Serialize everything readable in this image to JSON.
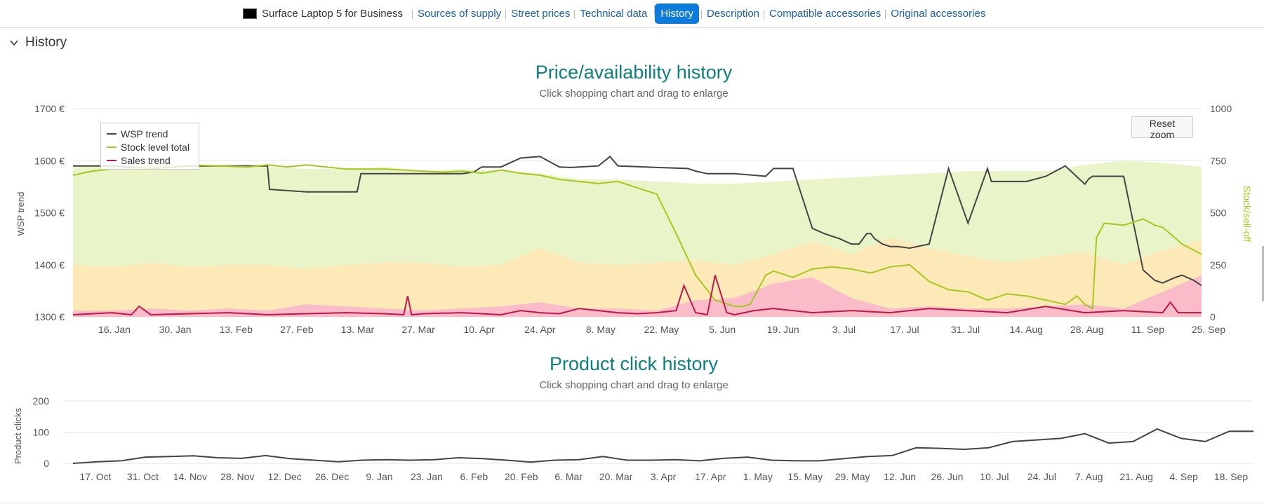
{
  "nav": {
    "product": "Surface Laptop 5 for Business",
    "items": [
      {
        "label": "Sources of supply",
        "active": false
      },
      {
        "label": "Street prices",
        "active": false
      },
      {
        "label": "Technical data",
        "active": false
      },
      {
        "label": "History",
        "active": true
      },
      {
        "label": "Description",
        "active": false
      },
      {
        "label": "Compatible accessories",
        "active": false
      },
      {
        "label": "Original accessories",
        "active": false
      }
    ]
  },
  "section": {
    "title": "History"
  },
  "colors": {
    "wsp": "#444444",
    "stock": "#a5c81e",
    "sales": "#c0174b",
    "band_green": "#e9f5c8",
    "band_yellow": "#fde9b8",
    "band_red": "#f9bcc8",
    "title": "#0d7f7f",
    "accent": "#0c7bdc"
  },
  "chart_data": [
    {
      "type": "line",
      "title": "Price/availability history",
      "subtitle": "Click shopping chart and drag to enlarge",
      "reset_label": "Reset zoom",
      "ylabel": "WSP trend",
      "y2label": "Stock/sell-off",
      "ylim": [
        1300,
        1700
      ],
      "y_ticks": [
        1300,
        1400,
        1500,
        1600,
        1700
      ],
      "y_tick_labels": [
        "1300 €",
        "1400 €",
        "1500 €",
        "1600 €",
        "1700 €"
      ],
      "y2lim": [
        0,
        1000
      ],
      "y2_ticks": [
        "0",
        "250",
        "500",
        "750",
        "1000"
      ],
      "x_ticks": [
        "16. Jan",
        "30. Jan",
        "13. Feb",
        "27. Feb",
        "13. Mar",
        "27. Mar",
        "10. Apr",
        "24. Apr",
        "8. May",
        "22. May",
        "5. Jun",
        "19. Jun",
        "3. Jul",
        "17. Jul",
        "31. Jul",
        "14. Aug",
        "28. Aug",
        "11. Sep",
        "25. Sep"
      ],
      "xlim_days": [
        0,
        270
      ],
      "legend_position": "top-left",
      "series": [
        {
          "name": "WSP trend",
          "axis": "left",
          "x": [
            0,
            5,
            10,
            20,
            30,
            35,
            40,
            50,
            50.5,
            60,
            65,
            73,
            74,
            85,
            90,
            100,
            103,
            105,
            108,
            110,
            115,
            120,
            125,
            128,
            130,
            135,
            138,
            140,
            150,
            158,
            160,
            163,
            170,
            175,
            178,
            180,
            185,
            190,
            193,
            197,
            200,
            202,
            203,
            204,
            205,
            206,
            208,
            210,
            212,
            215,
            220,
            225,
            230,
            235,
            236,
            237,
            240,
            245,
            250,
            255,
            260,
            261,
            262,
            263,
            265,
            270,
            275,
            278,
            280,
            283,
            285,
            288,
            290
          ],
          "y": [
            1590,
            1590,
            1590,
            1585,
            1590,
            1590,
            1590,
            1590,
            1545,
            1540,
            1540,
            1540,
            1575,
            1575,
            1575,
            1575,
            1578,
            1588,
            1588,
            1588,
            1605,
            1608,
            1588,
            1587,
            1588,
            1590,
            1608,
            1590,
            1587,
            1585,
            1580,
            1575,
            1575,
            1572,
            1570,
            1585,
            1585,
            1470,
            1460,
            1450,
            1440,
            1440,
            1450,
            1460,
            1460,
            1450,
            1440,
            1435,
            1435,
            1432,
            1440,
            1585,
            1480,
            1585,
            1560,
            1560,
            1560,
            1560,
            1570,
            1590,
            1555,
            1565,
            1570,
            1570,
            1570,
            1570,
            1390,
            1370,
            1365,
            1375,
            1380,
            1370,
            1360
          ]
        },
        {
          "name": "Stock level total",
          "axis": "right",
          "x": [
            0,
            5,
            10,
            20,
            30,
            45,
            50,
            55,
            60,
            70,
            80,
            90,
            95,
            100,
            105,
            110,
            115,
            120,
            125,
            130,
            135,
            140,
            145,
            150,
            155,
            160,
            165,
            170,
            172,
            174,
            178,
            180,
            185,
            190,
            195,
            200,
            205,
            210,
            215,
            220,
            225,
            230,
            235,
            240,
            245,
            250,
            255,
            258,
            260,
            262,
            263,
            265,
            270,
            275,
            278,
            280,
            285,
            290
          ],
          "y": [
            680,
            700,
            710,
            715,
            730,
            720,
            730,
            720,
            730,
            710,
            710,
            700,
            695,
            700,
            690,
            705,
            690,
            680,
            660,
            650,
            640,
            650,
            620,
            590,
            400,
            200,
            80,
            50,
            50,
            60,
            200,
            220,
            190,
            230,
            240,
            230,
            210,
            240,
            250,
            170,
            130,
            120,
            80,
            110,
            100,
            80,
            60,
            100,
            60,
            40,
            380,
            450,
            440,
            470,
            440,
            430,
            350,
            300
          ]
        },
        {
          "name": "Sales trend",
          "axis": "right",
          "x": [
            0,
            10,
            15,
            17,
            20,
            30,
            40,
            50,
            60,
            70,
            80,
            85,
            86,
            87,
            90,
            100,
            110,
            115,
            120,
            125,
            130,
            135,
            140,
            145,
            150,
            155,
            157,
            160,
            163,
            165,
            168,
            170,
            175,
            180,
            190,
            200,
            210,
            220,
            230,
            240,
            250,
            260,
            270,
            280,
            282,
            284,
            290
          ],
          "y": [
            10,
            20,
            10,
            50,
            10,
            15,
            20,
            10,
            15,
            20,
            15,
            10,
            100,
            10,
            15,
            20,
            10,
            30,
            20,
            15,
            40,
            30,
            20,
            15,
            20,
            30,
            150,
            20,
            10,
            200,
            20,
            10,
            30,
            40,
            20,
            30,
            20,
            40,
            30,
            20,
            50,
            20,
            30,
            20,
            70,
            20,
            20
          ]
        }
      ],
      "bands": [
        {
          "name": "green",
          "x": [
            0,
            10,
            20,
            30,
            40,
            50,
            60,
            70,
            80,
            90,
            100,
            110,
            120,
            130,
            140,
            150,
            160,
            170,
            180,
            190,
            200,
            210,
            220,
            230,
            240,
            250,
            260,
            270,
            280,
            290
          ],
          "y": [
            730,
            720,
            720,
            730,
            730,
            720,
            710,
            710,
            720,
            700,
            710,
            700,
            690,
            660,
            660,
            650,
            640,
            640,
            650,
            660,
            670,
            680,
            690,
            700,
            700,
            700,
            730,
            750,
            740,
            720
          ]
        },
        {
          "name": "yellow",
          "x": [
            0,
            10,
            20,
            30,
            40,
            50,
            60,
            70,
            80,
            90,
            100,
            110,
            120,
            130,
            140,
            150,
            160,
            170,
            180,
            190,
            200,
            210,
            220,
            230,
            240,
            250,
            260,
            270,
            280,
            290
          ],
          "y": [
            250,
            240,
            260,
            240,
            250,
            250,
            230,
            250,
            260,
            260,
            240,
            250,
            330,
            260,
            250,
            260,
            270,
            250,
            300,
            360,
            300,
            380,
            330,
            290,
            260,
            290,
            310,
            250,
            320,
            370
          ]
        },
        {
          "name": "red",
          "x": [
            0,
            10,
            20,
            30,
            40,
            50,
            60,
            70,
            80,
            90,
            100,
            110,
            120,
            130,
            140,
            150,
            160,
            170,
            180,
            190,
            200,
            210,
            220,
            230,
            240,
            250,
            260,
            270,
            280,
            290
          ],
          "y": [
            30,
            30,
            40,
            30,
            40,
            30,
            60,
            50,
            40,
            30,
            40,
            50,
            70,
            40,
            40,
            30,
            80,
            90,
            160,
            190,
            90,
            40,
            50,
            40,
            40,
            50,
            60,
            40,
            120,
            200
          ]
        }
      ]
    },
    {
      "type": "line",
      "title": "Product click history",
      "subtitle": "Click shopping chart and drag to enlarge",
      "ylabel": "Product clicks",
      "ylim": [
        0,
        200
      ],
      "y_ticks": [
        0,
        100,
        200
      ],
      "x_ticks": [
        "17. Oct",
        "31. Oct",
        "14. Nov",
        "28. Nov",
        "12. Dec",
        "26. Dec",
        "9. Jan",
        "23. Jan",
        "6. Feb",
        "20. Feb",
        "6. Mar",
        "20. Mar",
        "3. Apr",
        "17. Apr",
        "1. May",
        "15. May",
        "29. May",
        "12. Jun",
        "26. Jun",
        "10. Jul",
        "24. Jul",
        "7. Aug",
        "21. Aug",
        "4. Sep",
        "18. Sep"
      ],
      "series": [
        {
          "name": "Product clicks",
          "x": [
            0,
            7,
            14,
            21,
            28,
            35,
            42,
            49,
            56,
            63,
            70,
            77,
            84,
            91,
            98,
            105,
            112,
            119,
            126,
            133,
            140,
            147,
            154,
            161,
            168,
            175,
            182,
            189,
            196,
            203,
            210,
            217,
            224,
            231,
            238,
            245,
            252,
            259,
            266,
            273,
            280,
            287,
            294,
            301,
            308,
            315,
            322,
            329,
            336,
            343
          ],
          "y": [
            0,
            5,
            8,
            20,
            22,
            24,
            18,
            16,
            25,
            15,
            10,
            5,
            10,
            12,
            10,
            12,
            18,
            15,
            10,
            4,
            10,
            12,
            22,
            10,
            10,
            12,
            8,
            16,
            20,
            10,
            8,
            8,
            15,
            22,
            25,
            50,
            48,
            45,
            50,
            70,
            75,
            80,
            95,
            65,
            70,
            110,
            80,
            70,
            103,
            103
          ]
        }
      ]
    }
  ]
}
